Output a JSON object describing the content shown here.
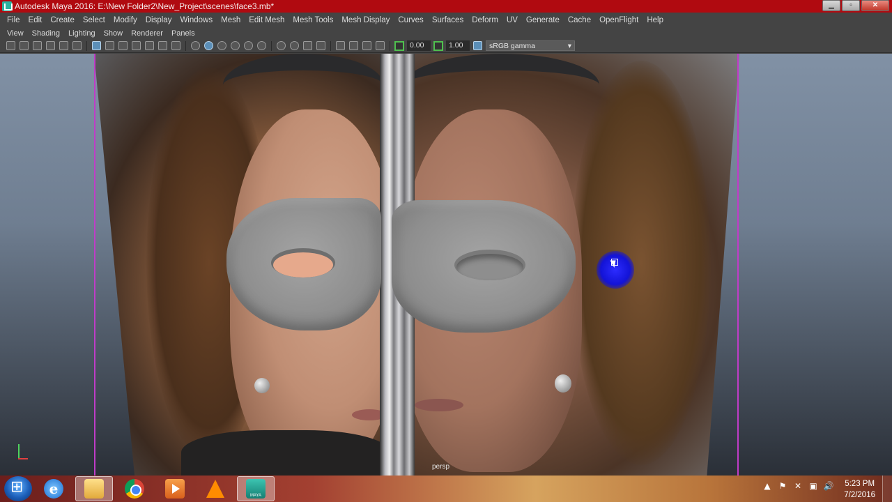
{
  "window": {
    "title": "Autodesk Maya 2016: E:\\New Folder2\\New_Project\\scenes\\face3.mb*",
    "controls": {
      "minimize": "▁",
      "maximize": "▫",
      "close": "✕"
    }
  },
  "menubar": {
    "items": [
      "File",
      "Edit",
      "Create",
      "Select",
      "Modify",
      "Display",
      "Windows",
      "Mesh",
      "Edit Mesh",
      "Mesh Tools",
      "Mesh Display",
      "Curves",
      "Surfaces",
      "Deform",
      "UV",
      "Generate",
      "Cache",
      "OpenFlight",
      "Help"
    ]
  },
  "panel_menu": {
    "items": [
      "View",
      "Shading",
      "Lighting",
      "Show",
      "Renderer",
      "Panels"
    ]
  },
  "toolbar": {
    "exposure_value": "0.00",
    "gamma_value": "1.00",
    "color_space": "sRGB gamma",
    "dropdown_arrow": "▾"
  },
  "viewport": {
    "camera_label": "persp",
    "plane_edge_color": "#c03cc8",
    "cursor_color": "#1a1ae0"
  },
  "taskbar": {
    "apps": [
      "start-orb",
      "internet-explorer",
      "file-explorer",
      "chrome",
      "media-player",
      "vlc",
      "maya"
    ],
    "maya_label": "MAYA",
    "tray_icons": [
      "show-hidden-icon",
      "network-icon",
      "flag-icon",
      "monitor-icon",
      "volume-icon"
    ],
    "tray_glyphs": [
      "▲",
      "⚑",
      "✕",
      "▣",
      "🔊"
    ],
    "time": "5:23 PM",
    "date": "7/2/2016"
  }
}
